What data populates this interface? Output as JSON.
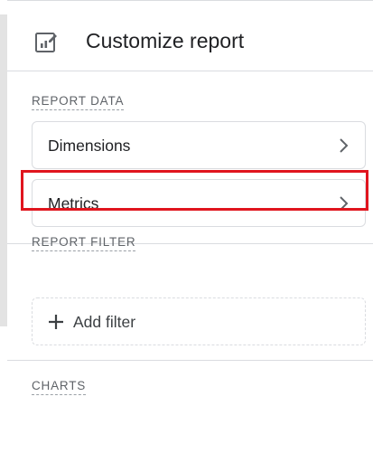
{
  "header": {
    "title": "Customize report",
    "icon": "chart-edit-icon"
  },
  "sections": {
    "report_data": {
      "label": "REPORT DATA",
      "items": [
        {
          "label": "Dimensions",
          "icon": "chevron-right-icon"
        },
        {
          "label": "Metrics",
          "icon": "chevron-right-icon",
          "highlighted": true
        }
      ]
    },
    "report_filter": {
      "label": "REPORT FILTER",
      "add_filter_label": "Add filter",
      "icon": "plus-icon"
    },
    "charts": {
      "label": "CHARTS"
    }
  },
  "colors": {
    "highlight": "#e0151e",
    "text": "#202124",
    "muted": "#5f6368",
    "border": "#dadce0"
  }
}
